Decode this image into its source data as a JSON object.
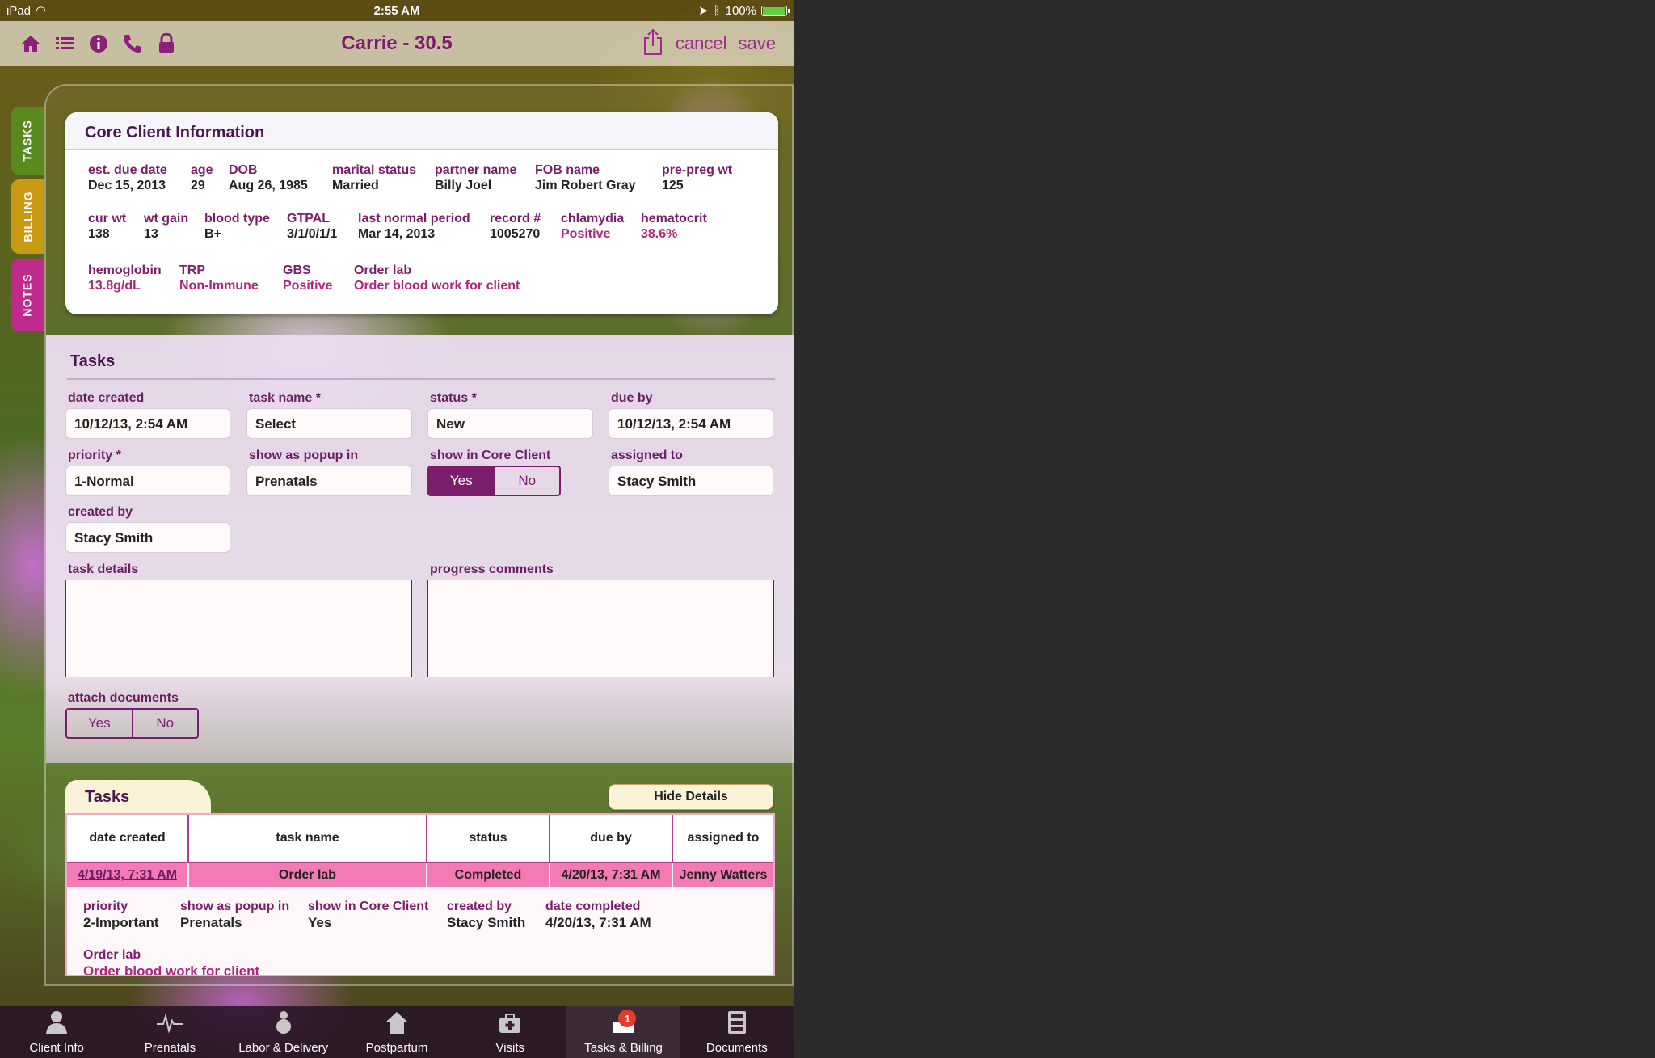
{
  "status_bar": {
    "device": "iPad",
    "time": "2:55 AM",
    "battery": "100%"
  },
  "nav": {
    "title": "Carrie - 30.5",
    "cancel": "cancel",
    "save": "save"
  },
  "side_tabs": [
    "TASKS",
    "BILLING",
    "NOTES"
  ],
  "core": {
    "title": "Core Client Information",
    "fields": [
      {
        "label": "est. due date",
        "value": "Dec 15, 2013"
      },
      {
        "label": "age",
        "value": "29"
      },
      {
        "label": "DOB",
        "value": "Aug 26, 1985"
      },
      {
        "label": "marital status",
        "value": "Married"
      },
      {
        "label": "partner name",
        "value": "Billy Joel"
      },
      {
        "label": "FOB name",
        "value": "Jim Robert Gray"
      },
      {
        "label": "pre-preg wt",
        "value": "125"
      },
      {
        "label": "cur wt",
        "value": "138"
      },
      {
        "label": "wt gain",
        "value": "13"
      },
      {
        "label": "blood type",
        "value": "B+"
      },
      {
        "label": "GTPAL",
        "value": "3/1/0/1/1"
      },
      {
        "label": "last normal period",
        "value": "Mar 14, 2013"
      },
      {
        "label": "record #",
        "value": "1005270"
      },
      {
        "label": "chlamydia",
        "value": "Positive"
      },
      {
        "label": "hematocrit",
        "value": "38.6%"
      },
      {
        "label": "hemoglobin",
        "value": "13.8g/dL"
      },
      {
        "label": "TRP",
        "value": "Non-Immune"
      },
      {
        "label": "GBS",
        "value": "Positive"
      },
      {
        "label": "Order lab",
        "value": "Order blood work for client"
      }
    ]
  },
  "form": {
    "title": "Tasks",
    "date_created_label": "date created",
    "date_created": "10/12/13, 2:54 AM",
    "task_name_label": "task name *",
    "task_name": "Select",
    "status_label": "status *",
    "status": "New",
    "due_by_label": "due by",
    "due_by": "10/12/13, 2:54 AM",
    "priority_label": "priority *",
    "priority": "1-Normal",
    "popup_label": "show as popup in",
    "popup": "Prenatals",
    "core_label": "show in Core Client",
    "yes": "Yes",
    "no": "No",
    "assigned_label": "assigned to",
    "assigned": "Stacy Smith",
    "created_by_label": "created by",
    "created_by": "Stacy Smith",
    "details_label": "task details",
    "progress_label": "progress comments",
    "attach_label": "attach documents"
  },
  "list": {
    "tab": "Tasks",
    "hide_details": "Hide Details",
    "headers": [
      "date created",
      "task name",
      "status",
      "due by",
      "assigned to"
    ],
    "row": [
      "4/19/13, 7:31 AM",
      "Order lab",
      "Completed",
      "4/20/13, 7:31 AM",
      "Jenny Watters"
    ],
    "details": [
      {
        "label": "priority",
        "value": "2-Important"
      },
      {
        "label": "show as popup in",
        "value": "Prenatals"
      },
      {
        "label": "show in Core Client",
        "value": "Yes"
      },
      {
        "label": "created by",
        "value": "Stacy Smith"
      },
      {
        "label": "date completed",
        "value": "4/20/13, 7:31 AM"
      }
    ],
    "lab_label": "Order lab",
    "lab_value": "Order blood work for client"
  },
  "tabbar": [
    {
      "label": "Client Info",
      "icon": "person-icon"
    },
    {
      "label": "Prenatals",
      "icon": "heartbeat-icon"
    },
    {
      "label": "Labor & Delivery",
      "icon": "baby-icon"
    },
    {
      "label": "Postpartum",
      "icon": "house-icon"
    },
    {
      "label": "Visits",
      "icon": "medical-bag-icon"
    },
    {
      "label": "Tasks & Billing",
      "icon": "inbox-icon",
      "badge": "1"
    },
    {
      "label": "Documents",
      "icon": "cabinet-icon"
    }
  ],
  "colors": {
    "accent": "#7b1c6c",
    "highlight": "#f47ab6",
    "tasks_tab": "#5a8a1e",
    "billing_tab": "#c89a12",
    "notes_tab": "#c02a8c"
  }
}
